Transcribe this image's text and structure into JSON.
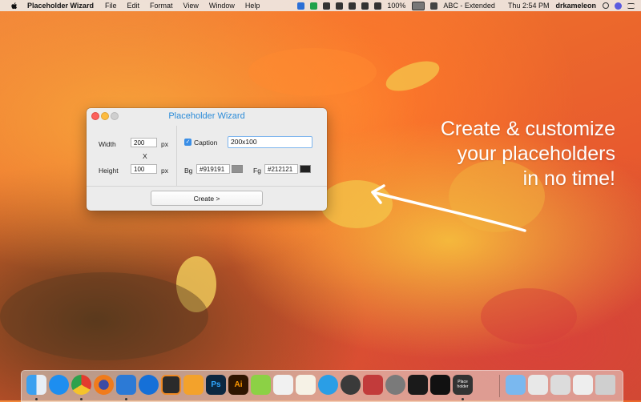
{
  "menubar": {
    "app_name": "Placeholder Wizard",
    "menus": [
      "File",
      "Edit",
      "Format",
      "View",
      "Window",
      "Help"
    ],
    "battery": "100%",
    "input_source": "ABC - Extended",
    "clock": "Thu 2:54 PM",
    "user": "drkameleon"
  },
  "window": {
    "title": "Placeholder Wizard",
    "width_label": "Width",
    "width_value": "200",
    "height_label": "Height",
    "height_value": "100",
    "unit_px": "px",
    "times_sign": "X",
    "caption_label": "Caption",
    "caption_checked": true,
    "caption_value": "200x100",
    "bg_label": "Bg",
    "bg_value": "#919191",
    "bg_color": "#919191",
    "fg_label": "Fg",
    "fg_value": "#212121",
    "fg_color": "#212121",
    "create_label": "Create >"
  },
  "promo": {
    "line1": "Create & customize",
    "line2": "your placeholders",
    "line3": "in no time!"
  },
  "dock": {
    "icons": [
      "finder-icon",
      "app-store-icon",
      "chrome-icon",
      "firefox-icon",
      "xcode-icon",
      "maps-icon",
      "sublime-text-icon",
      "sketch-icon",
      "photoshop-icon",
      "illustrator-icon",
      "clip-icon",
      "numbers-icon",
      "textedit-icon",
      "dashboard-icon",
      "instruments-icon",
      "preview-icon",
      "system-preferences-icon",
      "activity-monitor-icon",
      "terminal-icon",
      "placeholder-wizard-icon"
    ],
    "right_icons": [
      "applications-folder-icon",
      "downloads-icon",
      "desktop-icon",
      "documents-icon",
      "trash-icon"
    ],
    "placeholder_app_label": "Place holder"
  }
}
